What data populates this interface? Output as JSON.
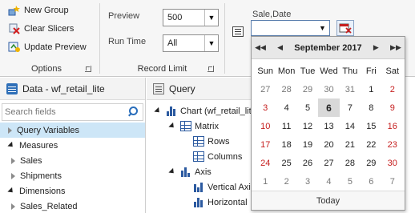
{
  "ribbon": {
    "options": {
      "new_group": "New Group",
      "clear_slicers": "Clear Slicers",
      "update_preview": "Update Preview",
      "caption": "Options"
    },
    "record_limit": {
      "preview_label": "Preview",
      "preview_value": "500",
      "run_time_label": "Run Time",
      "run_time_value": "All",
      "caption": "Record Limit"
    },
    "slicer": {
      "field_label": "Sale,Date",
      "value": ""
    }
  },
  "left_panel": {
    "title": "Data - wf_retail_lite",
    "search_placeholder": "Search fields",
    "items": [
      {
        "label": "Query Variables",
        "expanded": false,
        "selected": true
      },
      {
        "label": "Measures",
        "expanded": true,
        "selected": false
      },
      {
        "label": "Sales",
        "expanded": false,
        "selected": false
      },
      {
        "label": "Shipments",
        "expanded": false,
        "selected": false
      },
      {
        "label": "Dimensions",
        "expanded": true,
        "selected": false
      },
      {
        "label": "Sales_Related",
        "expanded": false,
        "selected": false
      }
    ]
  },
  "query_panel": {
    "title": "Query",
    "chart_node": "Chart (wf_retail_lite)",
    "matrix": "Matrix",
    "rows": "Rows",
    "columns": "Columns",
    "axis": "Axis",
    "vertical_axis": "Vertical Axis",
    "horizontal_axis": "Horizontal"
  },
  "calendar": {
    "month_title": "September 2017",
    "weekdays": [
      "Sun",
      "Mon",
      "Tue",
      "Wed",
      "Thu",
      "Fri",
      "Sat"
    ],
    "weeks": [
      [
        27,
        28,
        29,
        30,
        31,
        1,
        2
      ],
      [
        3,
        4,
        5,
        6,
        7,
        8,
        9
      ],
      [
        10,
        11,
        12,
        13,
        14,
        15,
        16
      ],
      [
        17,
        18,
        19,
        20,
        21,
        22,
        23
      ],
      [
        24,
        25,
        26,
        27,
        28,
        29,
        30
      ],
      [
        1,
        2,
        3,
        4,
        5,
        6,
        7
      ]
    ],
    "selected_day": 6,
    "today_label": "Today",
    "weekend_color": "#c62020"
  }
}
